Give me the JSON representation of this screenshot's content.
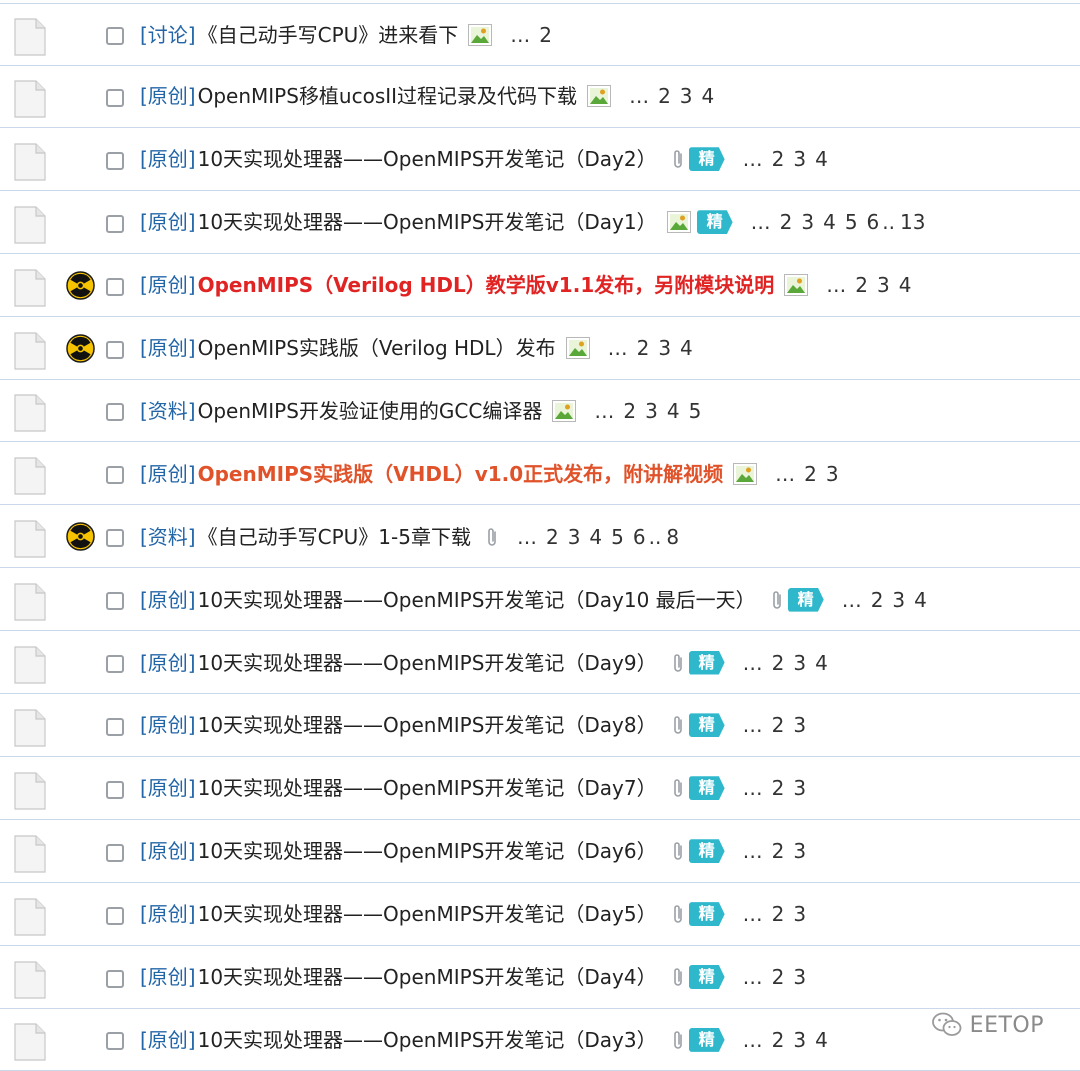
{
  "threads": [
    {
      "tag": "[讨论]",
      "title": "《自己动手写CPU》进来看下",
      "style": "normal",
      "hot": false,
      "image": true,
      "attachment": false,
      "best": false,
      "best_label": "",
      "pages": [
        "2"
      ],
      "pages_tail": null
    },
    {
      "tag": "[原创]",
      "title": "OpenMIPS移植ucosII过程记录及代码下载",
      "style": "normal",
      "hot": false,
      "image": true,
      "attachment": false,
      "best": false,
      "best_label": "",
      "pages": [
        "2",
        "3",
        "4"
      ],
      "pages_tail": null
    },
    {
      "tag": "[原创]",
      "title": "10天实现处理器——OpenMIPS开发笔记（Day2）",
      "style": "normal",
      "hot": false,
      "image": false,
      "attachment": true,
      "best": true,
      "best_label": "精",
      "pages": [
        "2",
        "3",
        "4"
      ],
      "pages_tail": null
    },
    {
      "tag": "[原创]",
      "title": "10天实现处理器——OpenMIPS开发笔记（Day1）",
      "style": "normal",
      "hot": false,
      "image": true,
      "attachment": false,
      "best": true,
      "best_label": "精",
      "pages": [
        "2",
        "3",
        "4",
        "5",
        "6"
      ],
      "pages_tail": "13"
    },
    {
      "tag": "[原创]",
      "title": "OpenMIPS（Verilog HDL）教学版v1.1发布，另附模块说明",
      "style": "red",
      "hot": true,
      "image": true,
      "attachment": false,
      "best": false,
      "best_label": "",
      "pages": [
        "2",
        "3",
        "4"
      ],
      "pages_tail": null
    },
    {
      "tag": "[原创]",
      "title": "OpenMIPS实践版（Verilog HDL）发布",
      "style": "normal",
      "hot": true,
      "image": true,
      "attachment": false,
      "best": false,
      "best_label": "",
      "pages": [
        "2",
        "3",
        "4"
      ],
      "pages_tail": null
    },
    {
      "tag": "[资料]",
      "title": "OpenMIPS开发验证使用的GCC编译器",
      "style": "normal",
      "hot": false,
      "image": true,
      "attachment": false,
      "best": false,
      "best_label": "",
      "pages": [
        "2",
        "3",
        "4",
        "5"
      ],
      "pages_tail": null
    },
    {
      "tag": "[原创]",
      "title": "OpenMIPS实践版（VHDL）v1.0正式发布，附讲解视频",
      "style": "orange",
      "hot": false,
      "image": true,
      "attachment": false,
      "best": false,
      "best_label": "",
      "pages": [
        "2",
        "3"
      ],
      "pages_tail": null
    },
    {
      "tag": "[资料]",
      "title": "《自己动手写CPU》1-5章下载",
      "style": "normal",
      "hot": true,
      "image": false,
      "attachment": true,
      "best": false,
      "best_label": "",
      "pages": [
        "2",
        "3",
        "4",
        "5",
        "6"
      ],
      "pages_tail": "8"
    },
    {
      "tag": "[原创]",
      "title": "10天实现处理器——OpenMIPS开发笔记（Day10 最后一天）",
      "style": "normal",
      "hot": false,
      "image": false,
      "attachment": true,
      "best": true,
      "best_label": "精",
      "pages": [
        "2",
        "3",
        "4"
      ],
      "pages_tail": null
    },
    {
      "tag": "[原创]",
      "title": "10天实现处理器——OpenMIPS开发笔记（Day9）",
      "style": "normal",
      "hot": false,
      "image": false,
      "attachment": true,
      "best": true,
      "best_label": "精",
      "pages": [
        "2",
        "3",
        "4"
      ],
      "pages_tail": null
    },
    {
      "tag": "[原创]",
      "title": "10天实现处理器——OpenMIPS开发笔记（Day8）",
      "style": "normal",
      "hot": false,
      "image": false,
      "attachment": true,
      "best": true,
      "best_label": "精",
      "pages": [
        "2",
        "3"
      ],
      "pages_tail": null
    },
    {
      "tag": "[原创]",
      "title": "10天实现处理器——OpenMIPS开发笔记（Day7）",
      "style": "normal",
      "hot": false,
      "image": false,
      "attachment": true,
      "best": true,
      "best_label": "精",
      "pages": [
        "2",
        "3"
      ],
      "pages_tail": null
    },
    {
      "tag": "[原创]",
      "title": "10天实现处理器——OpenMIPS开发笔记（Day6）",
      "style": "normal",
      "hot": false,
      "image": false,
      "attachment": true,
      "best": true,
      "best_label": "精",
      "pages": [
        "2",
        "3"
      ],
      "pages_tail": null
    },
    {
      "tag": "[原创]",
      "title": "10天实现处理器——OpenMIPS开发笔记（Day5）",
      "style": "normal",
      "hot": false,
      "image": false,
      "attachment": true,
      "best": true,
      "best_label": "精",
      "pages": [
        "2",
        "3"
      ],
      "pages_tail": null
    },
    {
      "tag": "[原创]",
      "title": "10天实现处理器——OpenMIPS开发笔记（Day4）",
      "style": "normal",
      "hot": false,
      "image": false,
      "attachment": true,
      "best": true,
      "best_label": "精",
      "pages": [
        "2",
        "3"
      ],
      "pages_tail": null
    },
    {
      "tag": "[原创]",
      "title": "10天实现处理器——OpenMIPS开发笔记（Day3）",
      "style": "normal",
      "hot": false,
      "image": false,
      "attachment": true,
      "best": true,
      "best_label": "精",
      "pages": [
        "2",
        "3",
        "4"
      ],
      "pages_tail": null
    }
  ],
  "pagination": {
    "ellipsis": "…",
    "tail_separator": ".."
  },
  "watermark": {
    "text": "EETOP"
  },
  "colors": {
    "tag": "#2366a8",
    "title_red": "#e02424",
    "title_orange": "#e0532a",
    "best_badge": "#2fb8cc",
    "row_border": "#c9d9e9"
  },
  "icons": {
    "thread": "thread-document-icon",
    "hot": "hot-thread-radiation-icon",
    "image": "image-attachment-icon",
    "attachment": "paperclip-icon",
    "best": "best-thread-badge",
    "watermark": "wechat-icon"
  }
}
